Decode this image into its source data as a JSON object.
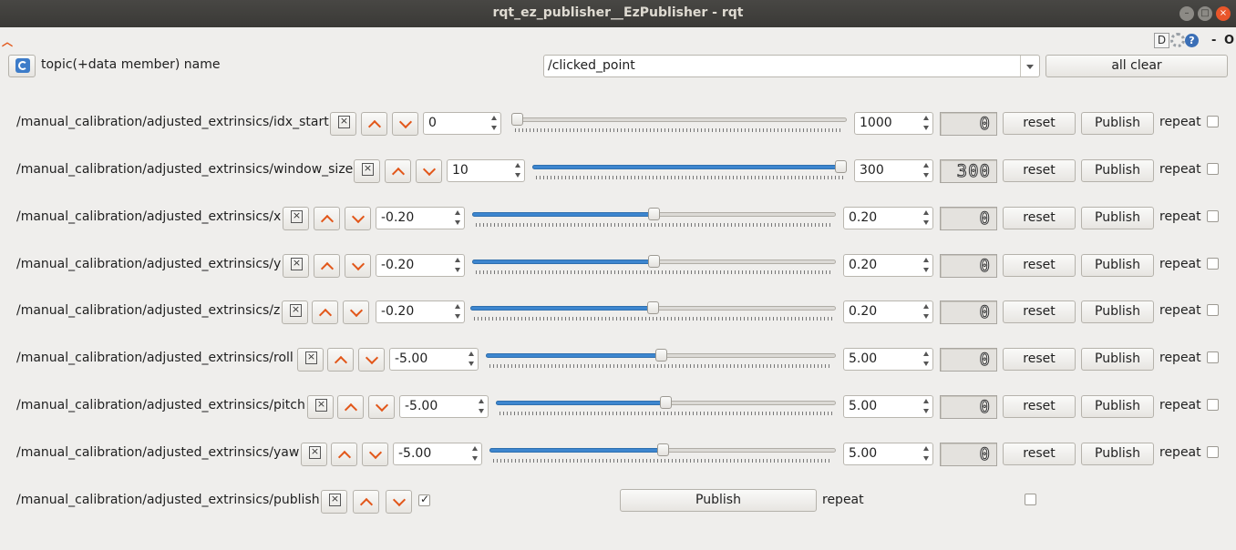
{
  "window": {
    "title": "rqt_ez_publisher__EzPublisher - rqt"
  },
  "dock": {
    "d_label": "D",
    "help_label": "?",
    "dash_label": "-",
    "o_label": "O"
  },
  "header": {
    "label": "topic(+data member) name",
    "topic_value": "/clicked_point",
    "all_clear_label": "all clear"
  },
  "labels": {
    "reset": "reset",
    "publish": "Publish",
    "repeat": "repeat"
  },
  "rows": [
    {
      "topic": "/manual_calibration/adjusted_extrinsics/idx_start",
      "min": "0",
      "max": "1000",
      "display": "0",
      "slider_fraction": 0.0,
      "repeat": false
    },
    {
      "topic": "/manual_calibration/adjusted_extrinsics/window_size",
      "min": "10",
      "max": "300",
      "display": "300",
      "slider_fraction": 1.0,
      "repeat": false
    },
    {
      "topic": "/manual_calibration/adjusted_extrinsics/x",
      "min": "-0.20",
      "max": "0.20",
      "display": "0",
      "slider_fraction": 0.5,
      "repeat": false
    },
    {
      "topic": "/manual_calibration/adjusted_extrinsics/y",
      "min": "-0.20",
      "max": "0.20",
      "display": "0",
      "slider_fraction": 0.5,
      "repeat": false
    },
    {
      "topic": "/manual_calibration/adjusted_extrinsics/z",
      "min": "-0.20",
      "max": "0.20",
      "display": "0",
      "slider_fraction": 0.5,
      "repeat": false
    },
    {
      "topic": "/manual_calibration/adjusted_extrinsics/roll",
      "min": "-5.00",
      "max": "5.00",
      "display": "0",
      "slider_fraction": 0.5,
      "repeat": false
    },
    {
      "topic": "/manual_calibration/adjusted_extrinsics/pitch",
      "min": "-5.00",
      "max": "5.00",
      "display": "0",
      "slider_fraction": 0.5,
      "repeat": false
    },
    {
      "topic": "/manual_calibration/adjusted_extrinsics/yaw",
      "min": "-5.00",
      "max": "5.00",
      "display": "0",
      "slider_fraction": 0.5,
      "repeat": false
    }
  ],
  "bool_row": {
    "topic": "/manual_calibration/adjusted_extrinsics/publish",
    "value_checked": true,
    "repeat": false
  },
  "colors": {
    "accent": "#3d86cf",
    "arrow": "#e2571a",
    "titlebar": "#3a3936",
    "close": "#e9562a"
  }
}
